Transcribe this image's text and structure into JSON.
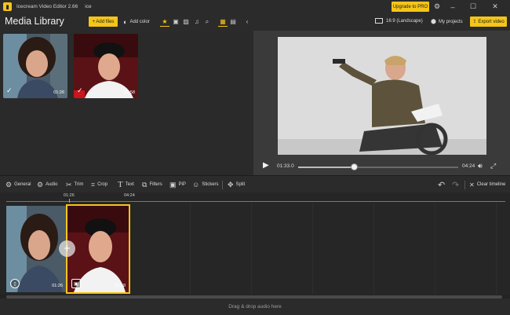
{
  "titlebar": {
    "app_name": "Icecream Video Editor 2.66",
    "project": "ice",
    "upgrade_label": "Upgrade to PRO",
    "icons": [
      "gear-icon",
      "minimize-icon",
      "maximize-icon",
      "close-icon"
    ]
  },
  "media_library": {
    "title": "Media Library",
    "add_files_label": "+ Add files",
    "add_color_label": "Add color",
    "filters": [
      "star-icon",
      "video-icon",
      "image-icon",
      "music-icon",
      "search-icon"
    ],
    "items": [
      {
        "duration": "01:26",
        "selected": true
      },
      {
        "duration": "02:58",
        "selected": true
      }
    ]
  },
  "preview": {
    "aspect_label": "16:9 (Landscape)",
    "my_projects_label": "My projects",
    "export_label": "Export video",
    "current_time": "01:33.0",
    "total_time": "04:24",
    "progress": 0.35
  },
  "toolbar": {
    "tools": [
      {
        "label": "General",
        "icon": "gear-icon"
      },
      {
        "label": "Audio",
        "icon": "audio-icon"
      },
      {
        "label": "Trim",
        "icon": "scissors-icon"
      },
      {
        "label": "Crop",
        "icon": "crop-icon"
      },
      {
        "label": "Text",
        "icon": "text-icon"
      },
      {
        "label": "Filters",
        "icon": "filters-icon"
      },
      {
        "label": "PiP",
        "icon": "pip-icon"
      },
      {
        "label": "Stickers",
        "icon": "sticker-icon"
      },
      {
        "label": "Split",
        "icon": "split-icon"
      }
    ],
    "clear_label": "Clear timeline"
  },
  "timeline": {
    "ruler_labels": [
      "01:26",
      "04:24"
    ],
    "clips": [
      {
        "duration": "01:26"
      },
      {
        "duration": "02:58"
      }
    ],
    "audio_drop_label": "Drag & drop audio here"
  },
  "colors": {
    "accent": "#f5c518",
    "background": "#232323",
    "panel": "#2a2a2a"
  }
}
